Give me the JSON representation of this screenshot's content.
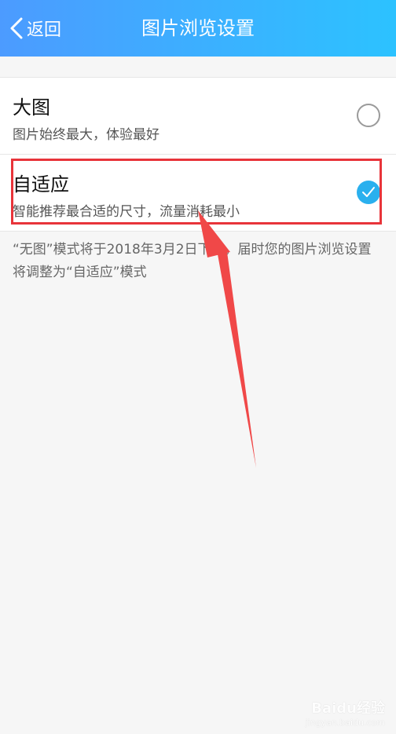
{
  "header": {
    "back_label": "返回",
    "title": "图片浏览设置",
    "gradient_colors": [
      "#4c9bff",
      "#2cc2ff"
    ]
  },
  "options": [
    {
      "title": "大图",
      "subtitle": "图片始终最大，体验最好",
      "selected": false
    },
    {
      "title": "自适应",
      "subtitle": "智能推荐最合适的尺寸，流量消耗最小",
      "selected": true
    }
  ],
  "note": "“无图”模式将于2018年3月2日下线，届时您的图片浏览设置将调整为“自适应”模式",
  "annotation": {
    "highlight_color": "#e8343a",
    "arrow_color": "#f04848"
  },
  "watermark": {
    "brand": "Baidu经验",
    "url": "jingyan.baidu.com"
  },
  "accent_color": "#2ab0ee"
}
